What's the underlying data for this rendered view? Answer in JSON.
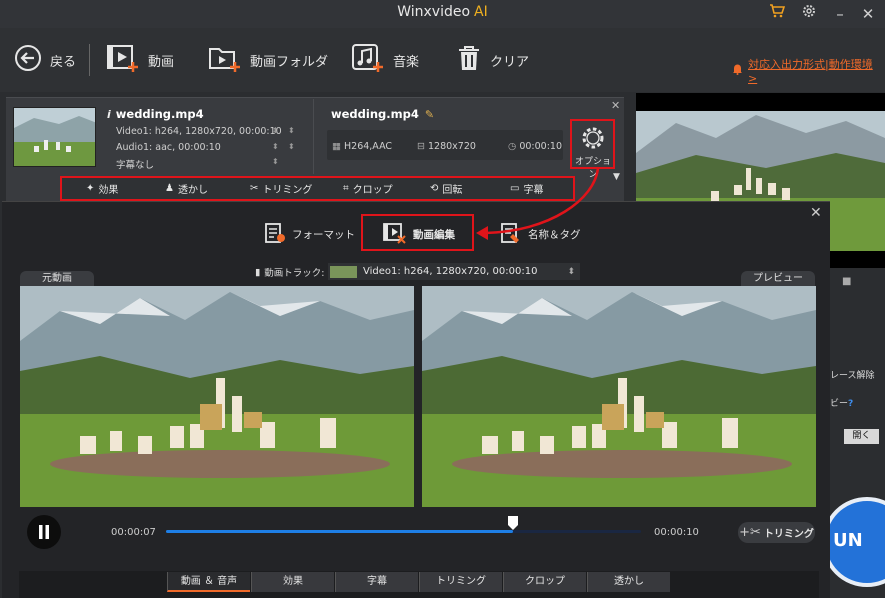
{
  "window": {
    "title": "Winxvideo",
    "title_suffix": "AI",
    "controls": [
      "cart-icon",
      "gear-icon",
      "minimize-icon",
      "close-icon"
    ]
  },
  "toolbar": {
    "back_label": "戻る",
    "video_label": "動画",
    "folder_label": "動画フォルダ",
    "music_label": "音楽",
    "clear_label": "クリア",
    "env_link": "対応入出力形式|動作環境 >"
  },
  "file": {
    "input_name": "wedding.mp4",
    "video_info": "Video1: h264, 1280x720, 00:00:10",
    "audio_info": "Audio1: aac, 00:00:10",
    "subtitle_info": "字幕なし",
    "output_name": "wedding.mp4",
    "output_codec": "H264,AAC",
    "output_resolution": "1280x720",
    "output_duration": "00:00:10",
    "option_label": "オプション"
  },
  "edit_bar": {
    "items": [
      "効果",
      "透かし",
      "トリミング",
      "クロップ",
      "回転",
      "字幕"
    ]
  },
  "dialog": {
    "tabs": [
      "フォーマット",
      "動画編集",
      "名称＆タグ"
    ],
    "active_tab": "動画編集",
    "original_label": "元動画",
    "preview_label": "プレビュー",
    "track_label": "動画トラック:",
    "track_value": "Video1: h264, 1280x720, 00:00:10",
    "time_current": "00:00:07",
    "time_total": "00:00:10",
    "progress": 0.73,
    "trim_button": "トリミング",
    "bottom_tabs": [
      "動画 ＆ 音声",
      "効果",
      "字幕",
      "トリミング",
      "クロップ",
      "透かし"
    ],
    "active_bottom_tab": "動画 ＆ 音声"
  },
  "right_panel": {
    "partial_text_1": "レース解除",
    "partial_text_2": "ビー",
    "help_mark": "?",
    "open_button": "開く",
    "run_label": "UN"
  },
  "colors": {
    "accent": "#f06a2a",
    "highlight_border": "#e0141a",
    "progress": "#1e7fe6",
    "run_button": "#2372d8",
    "ai_text": "#f0b020"
  }
}
